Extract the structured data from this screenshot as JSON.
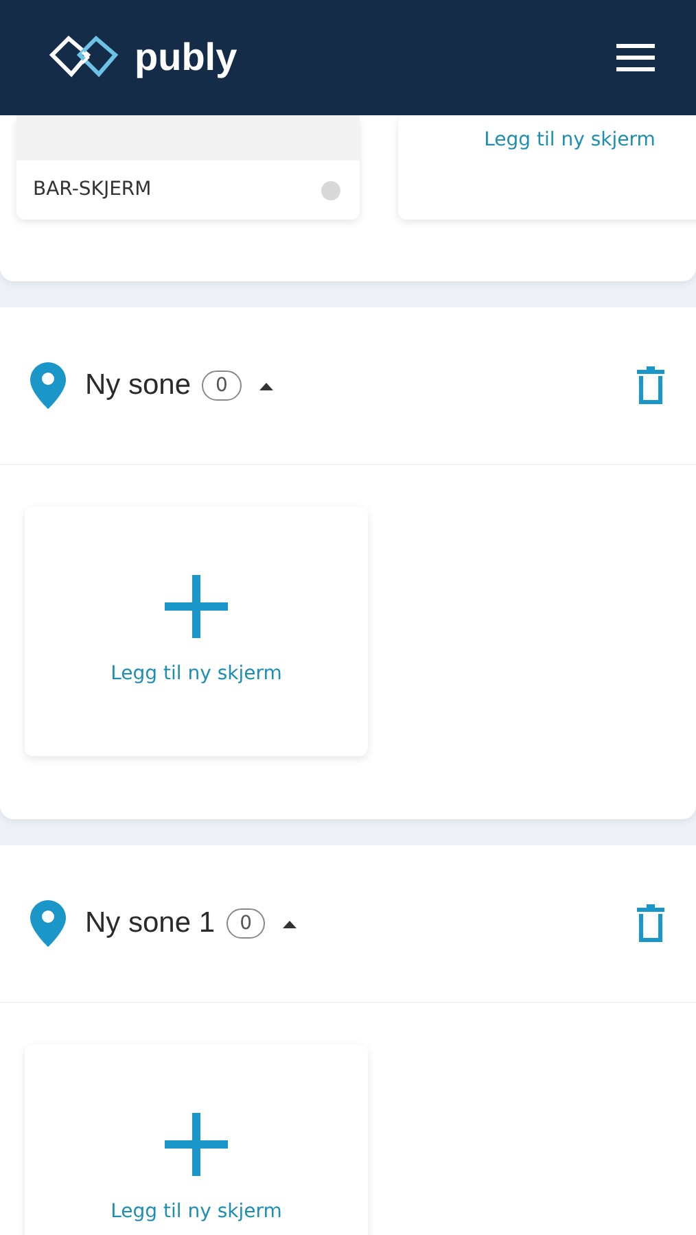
{
  "header": {
    "logo": "publy"
  },
  "zones": [
    {
      "cards": [
        {
          "kind": "screen",
          "name": "BAR-SKJERM",
          "online": false
        },
        {
          "kind": "add",
          "label": "Legg til ny skjerm"
        }
      ]
    },
    {
      "title": "Ny sone",
      "count": "0",
      "expanded": true,
      "cards": [
        {
          "kind": "add",
          "label": "Legg til ny skjerm"
        }
      ]
    },
    {
      "title": "Ny sone 1",
      "count": "0",
      "expanded": true,
      "cards": [
        {
          "kind": "add",
          "label": "Legg til ny skjerm"
        }
      ]
    }
  ]
}
